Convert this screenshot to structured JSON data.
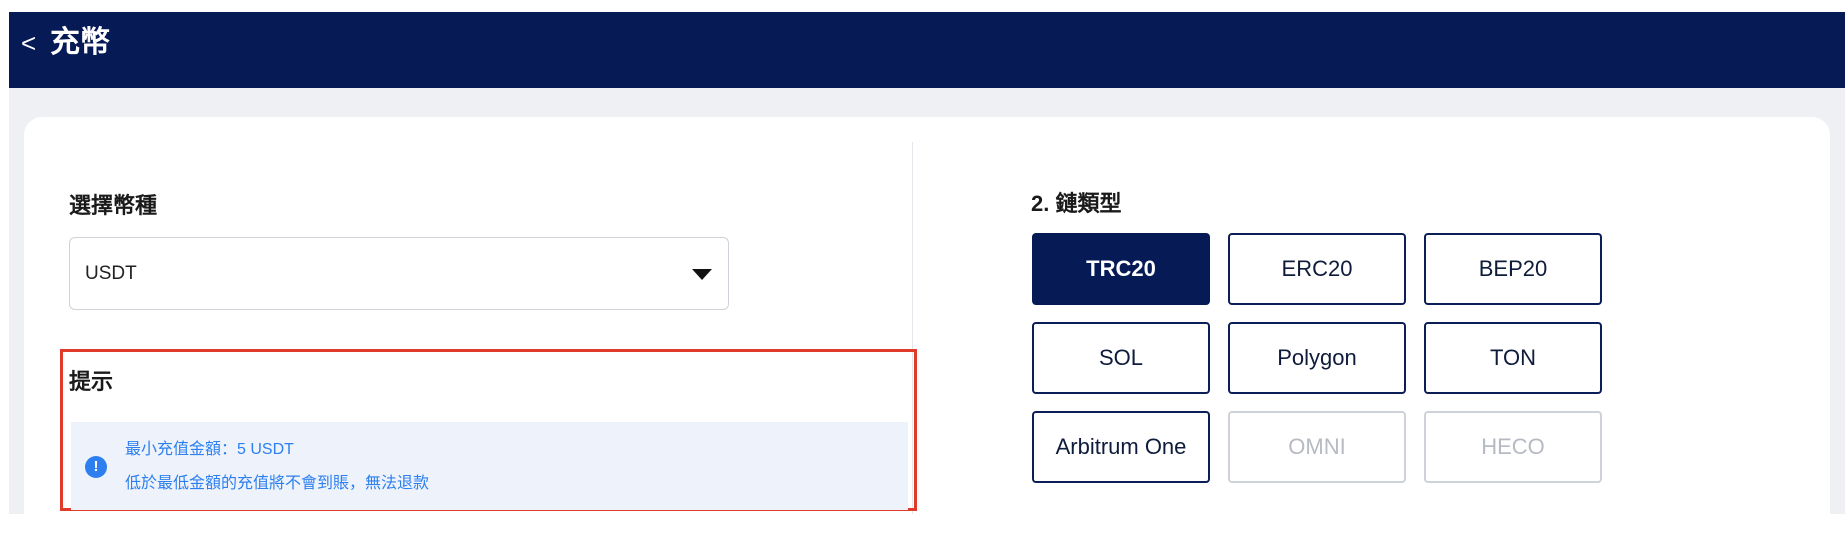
{
  "header": {
    "back_icon": "chevron-left-icon",
    "back_glyph": "<",
    "title": "充幣"
  },
  "currency": {
    "label": "選擇幣種",
    "selected": "USDT",
    "dropdown_icon": "caret-down-icon"
  },
  "tip": {
    "label": "提示",
    "icon": "info-icon",
    "icon_glyph": "!",
    "line1": "最小充值金額：5 USDT",
    "line2": "低於最低金額的充值將不會到賬，無法退款",
    "border_color": "#e03a2b",
    "text_color": "#2d7ff0"
  },
  "chain": {
    "label": "2. 鏈類型",
    "options": [
      {
        "label": "TRC20",
        "state": "selected"
      },
      {
        "label": "ERC20",
        "state": "enabled"
      },
      {
        "label": "BEP20",
        "state": "enabled"
      },
      {
        "label": "SOL",
        "state": "enabled"
      },
      {
        "label": "Polygon",
        "state": "enabled"
      },
      {
        "label": "TON",
        "state": "enabled"
      },
      {
        "label": "Arbitrum One",
        "state": "enabled"
      },
      {
        "label": "OMNI",
        "state": "disabled"
      },
      {
        "label": "HECO",
        "state": "disabled"
      }
    ]
  },
  "colors": {
    "navy": "#061a56",
    "background": "#eff0f3",
    "accent_blue": "#2d7ff0",
    "highlight_red": "#e03a2b"
  }
}
